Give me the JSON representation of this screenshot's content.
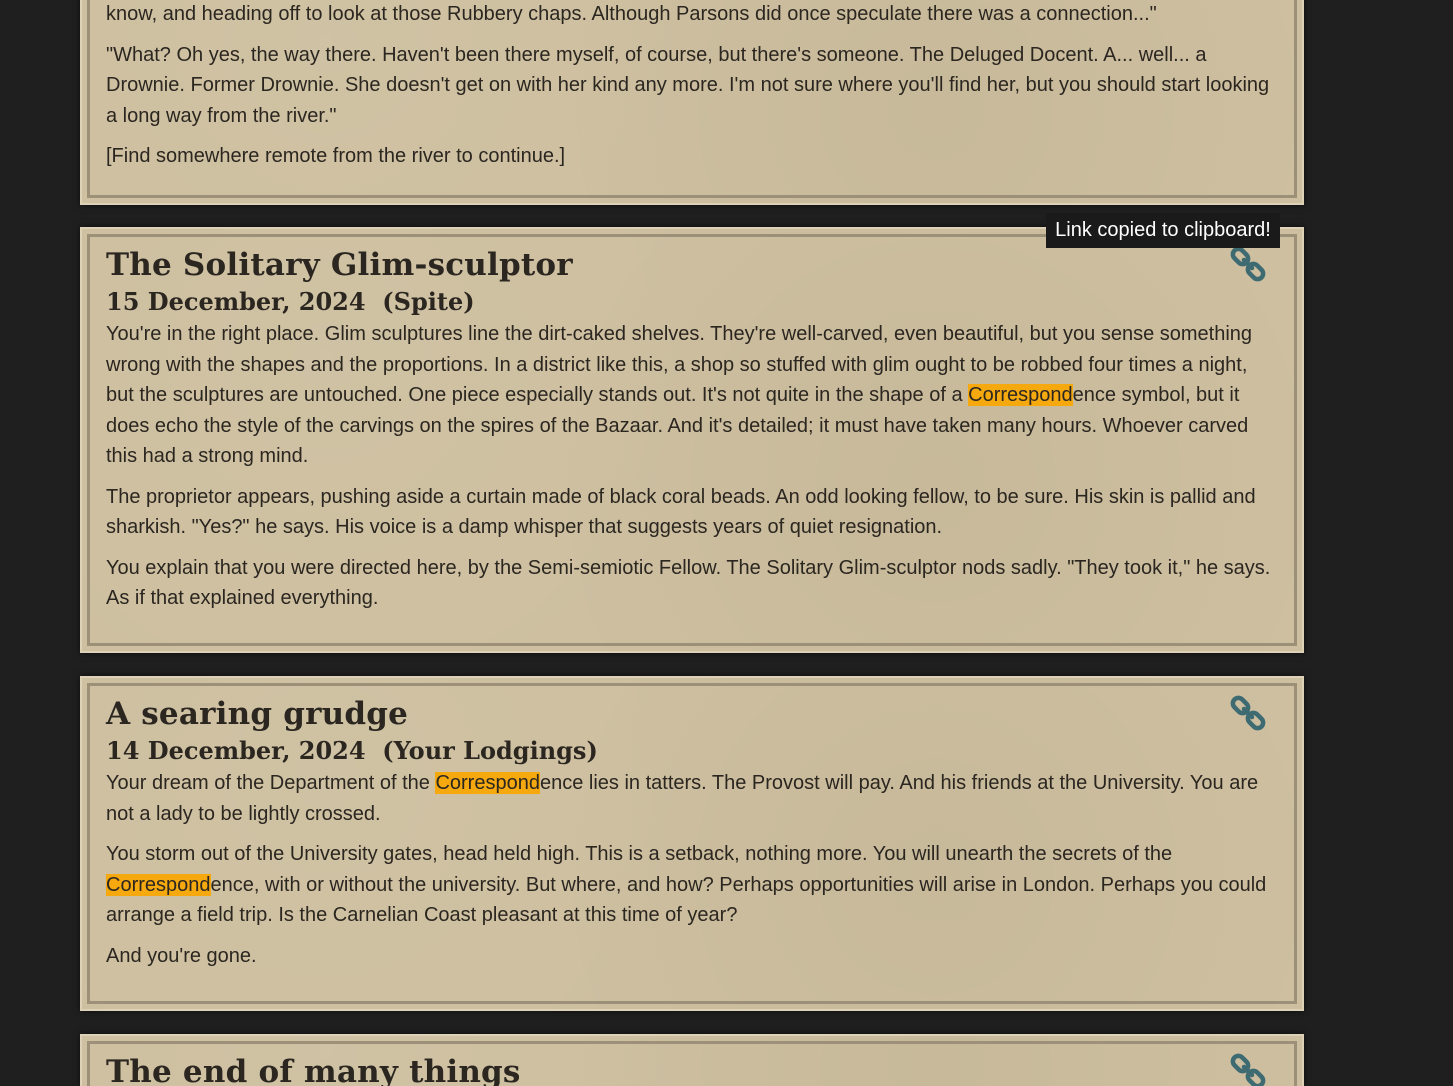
{
  "toast": "Link copied to clipboard!",
  "colors": {
    "page_background": "#1f1f1f",
    "card_background": "#cdbf9f",
    "highlight": "#f6a90f",
    "link_icon": "#3e6b72"
  },
  "entries": [
    {
      "title": "",
      "date": "",
      "paragraphs": [
        [
          "know, and heading off to look at those Rubbery chaps. Although Parsons did once speculate there was a connection...\""
        ],
        [
          "\"What? Oh yes, the way there. Haven't been there myself, of course, but there's someone. The Deluged Docent. A... well... a Drownie. Former Drownie. She doesn't get on with her kind any more. I'm not sure where you'll find her, but you should start looking a long way from the river.\""
        ],
        [
          "[Find somewhere remote from the river to continue.]"
        ]
      ]
    },
    {
      "title": "The Solitary Glim-sculptor",
      "date": "15 December, 2024  (Spite)",
      "link_icon": "link-icon",
      "paragraphs": [
        [
          "You're in the right place. Glim sculptures line the dirt-caked shelves. They're well-carved, even beautiful, but you sense something wrong with the shapes and the proportions. In a district like this, a shop so stuffed with glim ought to be robbed four times a night, but the sculptures are untouched. One piece especially stands out. It's not quite in the shape of a ",
          "Correspond",
          "ence symbol, but it does echo the style of the carvings on the spires of the Bazaar. And it's detailed; it must have taken many hours. Whoever carved this had a strong mind."
        ],
        [
          "The proprietor appears, pushing aside a curtain made of black coral beads. An odd looking fellow, to be sure. His skin is pallid and sharkish. \"Yes?\" he says. His voice is a damp whisper that suggests years of quiet resignation."
        ],
        [
          "You explain that you were directed here, by the Semi-semiotic Fellow. The Solitary Glim-sculptor nods sadly. \"They took it,\" he says. As if that explained everything."
        ]
      ]
    },
    {
      "title": "A searing grudge",
      "date": "14 December, 2024  (Your Lodgings)",
      "link_icon": "link-icon",
      "paragraphs": [
        [
          "Your dream of the Department of the ",
          "Correspond",
          "ence lies in tatters. The Provost will pay. And his friends at the University. You are not a lady to be lightly crossed."
        ],
        [
          "You storm out of the University gates, head held high. This is a setback, nothing more. You will unearth the secrets of the ",
          "Correspond",
          "ence, with or without the university. But where, and how? Perhaps opportunities will arise in London. Perhaps you could arrange a field trip. Is the Carnelian Coast pleasant at this time of year?"
        ],
        [
          "And you're gone."
        ]
      ]
    },
    {
      "title": "The end of many things",
      "date": "",
      "link_icon": "link-icon",
      "paragraphs": []
    }
  ]
}
